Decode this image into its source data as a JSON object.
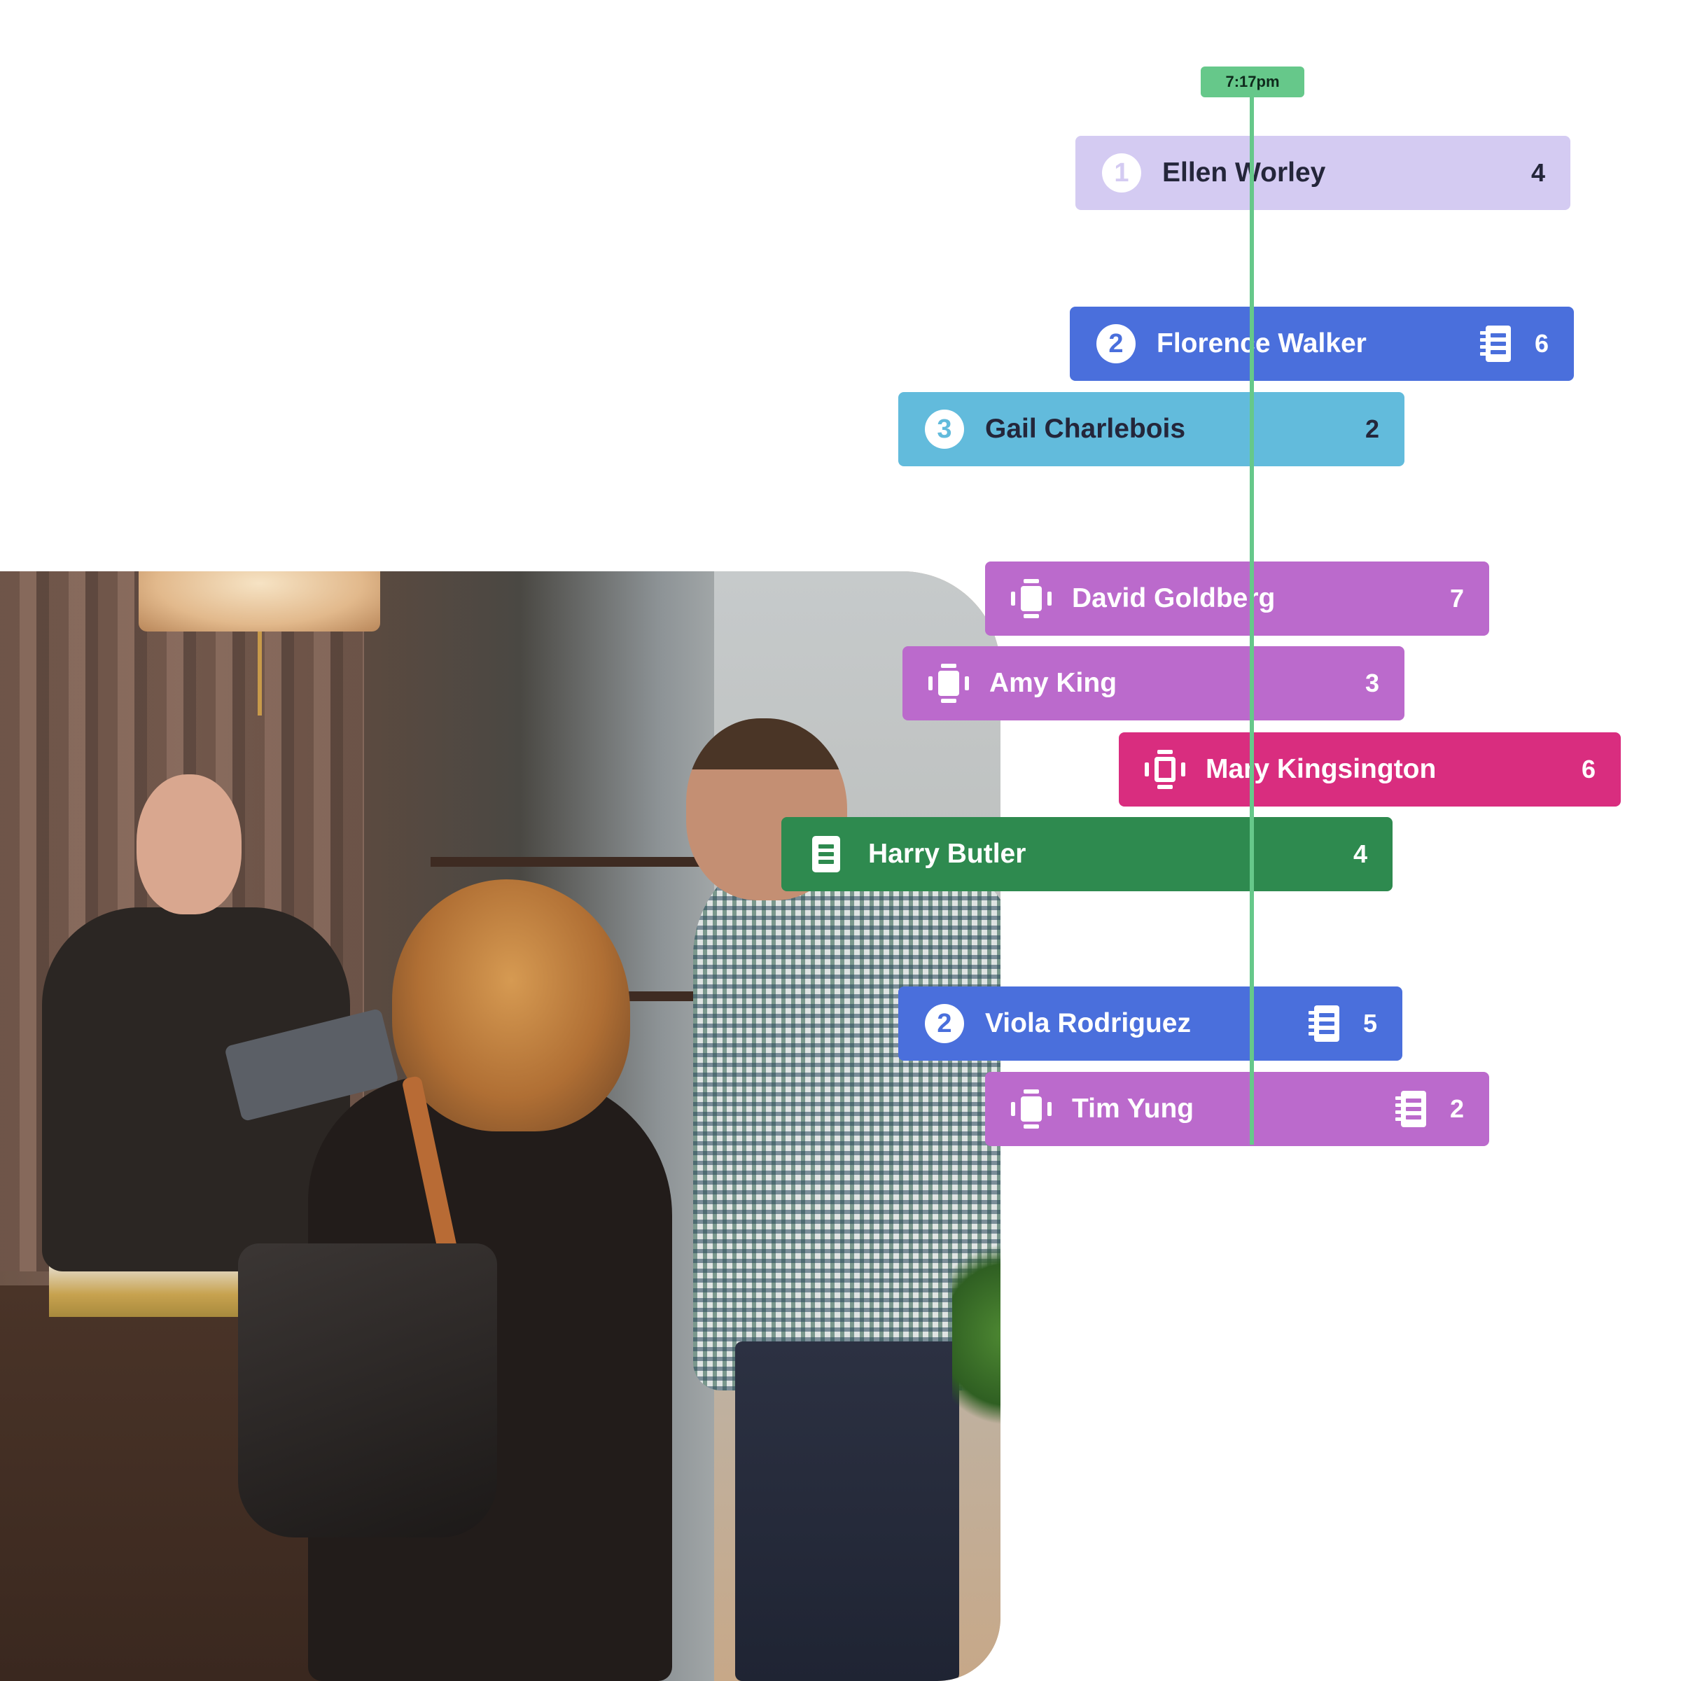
{
  "timeline": {
    "current_time_label": "7:17pm",
    "indicator_color": "#66c88a"
  },
  "reservations": [
    {
      "name": "Ellen Worley",
      "party_size": "4",
      "lead_type": "number",
      "lead_value": "1",
      "has_notes": false,
      "color": "#d4cbf2",
      "text_theme": "light"
    },
    {
      "name": "Florence Walker",
      "party_size": "6",
      "lead_type": "number",
      "lead_value": "2",
      "has_notes": true,
      "color": "#4a6fdc",
      "text_theme": "dark"
    },
    {
      "name": "Gail Charlebois",
      "party_size": "2",
      "lead_type": "number",
      "lead_value": "3",
      "has_notes": false,
      "color": "#62bbdc",
      "text_theme": "light"
    },
    {
      "name": "David Goldberg",
      "party_size": "7",
      "lead_type": "pager-device",
      "lead_value": "",
      "has_notes": false,
      "color": "#bb6acc",
      "text_theme": "dark"
    },
    {
      "name": "Amy King",
      "party_size": "3",
      "lead_type": "pager-device",
      "lead_value": "",
      "has_notes": false,
      "color": "#bb6acc",
      "text_theme": "dark"
    },
    {
      "name": "Mary Kingsington",
      "party_size": "6",
      "lead_type": "pager-device-active",
      "lead_value": "",
      "has_notes": false,
      "color": "#d92d7f",
      "text_theme": "dark"
    },
    {
      "name": "Harry Butler",
      "party_size": "4",
      "lead_type": "document",
      "lead_value": "",
      "has_notes": false,
      "color": "#2e8a4f",
      "text_theme": "dark"
    },
    {
      "name": "Viola Rodriguez",
      "party_size": "5",
      "lead_type": "number",
      "lead_value": "2",
      "has_notes": true,
      "color": "#4a6fdc",
      "text_theme": "dark"
    },
    {
      "name": "Tim Yung",
      "party_size": "2",
      "lead_type": "pager-device",
      "lead_value": "",
      "has_notes": true,
      "color": "#bb6acc",
      "text_theme": "dark"
    }
  ],
  "photo": {
    "description": "Host at a restaurant front desk holding a tablet, greeting a couple"
  }
}
